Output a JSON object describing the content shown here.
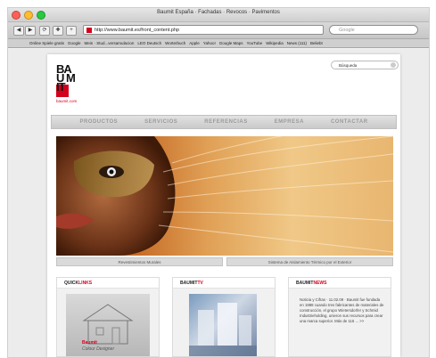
{
  "window": {
    "title": "Baumit España · Fachadas · Revocos · Pavimentos"
  },
  "toolbar": {
    "url": "http://www.baumit.es/front_content.php",
    "google_placeholder": "Google",
    "nav_glyphs": [
      "◀",
      "▶",
      "⟳",
      "✚",
      "+"
    ]
  },
  "bookmarks": [
    "Online Spiele gratis",
    "Google",
    "Mein · Stud...versamulacion",
    "LEO Deutsch",
    "Worterbuch",
    "Apple",
    "Yahoo!",
    "Google Maps",
    "YouTube",
    "Wikipedia",
    "News (111)",
    "Beliebt"
  ],
  "site": {
    "logo_text": "BAU MIT",
    "logo_url": "baumit.com",
    "search_label": "Búsqueda",
    "nav": [
      "PRODUCTOS",
      "SERVICIOS",
      "REFERENCIAS",
      "EMPRESA",
      "CONTACTAR"
    ],
    "hero_tabs": [
      "Revestimientos Murales",
      "Sistema de Aislamiento Térmico por el Exterior"
    ],
    "boxes": {
      "quicklinks": {
        "title_black": "QUICK",
        "title_red": "LINKS",
        "caption1": "Baumit",
        "caption2": "Colour Designer"
      },
      "tv": {
        "title_black": "BAUMIT",
        "title_red": "TV"
      },
      "news": {
        "title_black": "BAUMIT",
        "title_red": "NEWS",
        "text": "Noticia y Cifras · 11.02.09 · Baumit fue fundada en 1988 cuando tres fabricantes de materiales de construcción, el grupo Wietersdorfer y Schmid Industrieholding, unieron sus recursos para crear una marca superior. Más de 115 ... >>"
      }
    }
  },
  "colors": {
    "brand_red": "#d3001c",
    "nav_text": "#9a9a9a"
  }
}
